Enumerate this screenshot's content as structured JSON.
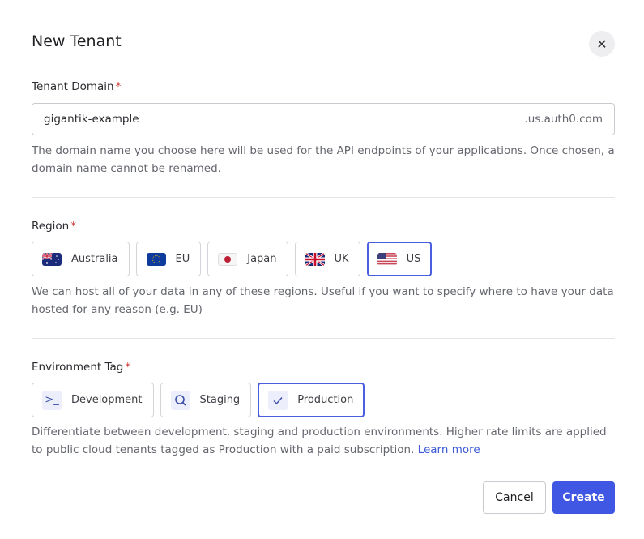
{
  "title": "New Tenant",
  "domain": {
    "label": "Tenant Domain",
    "required": "*",
    "value": "gigantik-example",
    "suffix": ".us.auth0.com",
    "help": "The domain name you choose here will be used for the API endpoints of your applications. Once chosen, a domain name cannot be renamed."
  },
  "region": {
    "label": "Region",
    "required": "*",
    "options": [
      {
        "label": "Australia",
        "icon": "australia-flag-icon"
      },
      {
        "label": "EU",
        "icon": "eu-flag-icon"
      },
      {
        "label": "Japan",
        "icon": "japan-flag-icon"
      },
      {
        "label": "UK",
        "icon": "uk-flag-icon"
      },
      {
        "label": "US",
        "icon": "us-flag-icon"
      }
    ],
    "selected": "US",
    "help": "We can host all of your data in any of these regions. Useful if you want to specify where to have your data hosted for any reason (e.g. EU)"
  },
  "environment": {
    "label": "Environment Tag",
    "required": "*",
    "options": [
      {
        "label": "Development",
        "icon": "terminal-icon"
      },
      {
        "label": "Staging",
        "icon": "search-icon"
      },
      {
        "label": "Production",
        "icon": "check-icon"
      }
    ],
    "selected": "Production",
    "help": "Differentiate between development, staging and production environments. Higher rate limits are applied to public cloud tenants tagged as Production with a paid subscription.",
    "learn_more": "Learn more"
  },
  "actions": {
    "cancel": "Cancel",
    "create": "Create"
  },
  "colors": {
    "accent": "#3f57e2",
    "required": "#d03c38"
  }
}
